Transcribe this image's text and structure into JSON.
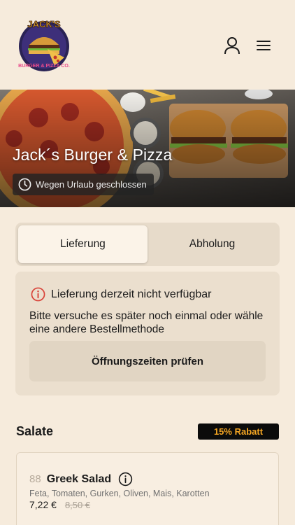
{
  "header": {
    "logo": {
      "top_text": "JACK'S",
      "bottom_text": "BURGER & PIZZA CO."
    },
    "account_icon": "user-icon",
    "menu_icon": "hamburger-menu-icon"
  },
  "hero": {
    "title": "Jack´s Burger & Pizza",
    "status": "Wegen Urlaub geschlossen",
    "status_icon": "clock-icon"
  },
  "order_mode": {
    "tabs": [
      {
        "label": "Lieferung",
        "active": true
      },
      {
        "label": "Abholung",
        "active": false
      }
    ]
  },
  "notice": {
    "icon": "info-icon",
    "icon_color": "#d9443a",
    "title": "Lieferung derzeit nicht verfügbar",
    "message": "Bitte versuche es später noch einmal oder wähle eine andere Bestellmethode",
    "button_label": "Öffnungszeiten prüfen"
  },
  "menu": {
    "section_title": "Salate",
    "discount_badge": "15% Rabatt",
    "accent_color": "#f5a623",
    "items": [
      {
        "number": "88",
        "name": "Greek Salad",
        "description": "Feta, Tomaten, Gurken, Oliven, Mais, Karotten",
        "price": "7,22 €",
        "old_price": "8,50 €"
      }
    ]
  }
}
